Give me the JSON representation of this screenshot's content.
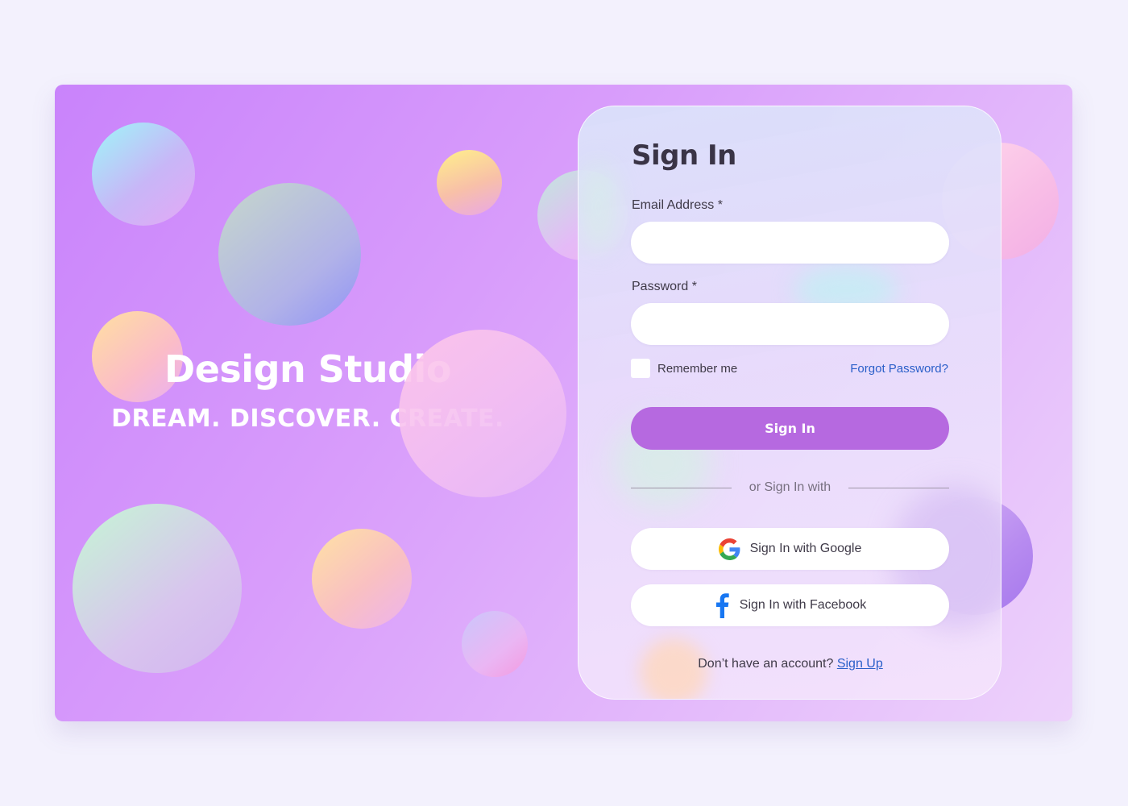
{
  "brand": {
    "title": "Design Studio",
    "tagline": "DREAM. DISCOVER. CREATE."
  },
  "signin": {
    "title": "Sign In",
    "email_label": "Email Address *",
    "email_value": "",
    "password_label": "Password *",
    "password_value": "",
    "remember_label": "Remember me",
    "remember_checked": false,
    "forgot_label": "Forgot Password?",
    "submit_label": "Sign In",
    "divider_text": "or Sign In with",
    "google_label": "Sign In with Google",
    "facebook_label": "Sign In with Facebook",
    "signup_prompt": "Don’t have an account?",
    "signup_link": "Sign Up"
  },
  "colors": {
    "accent": "#b669e0",
    "link": "#2a5fc9",
    "page_background": "#f3f1fd",
    "facebook": "#1877f2"
  },
  "icons": {
    "google": "google-icon",
    "facebook": "facebook-icon"
  }
}
